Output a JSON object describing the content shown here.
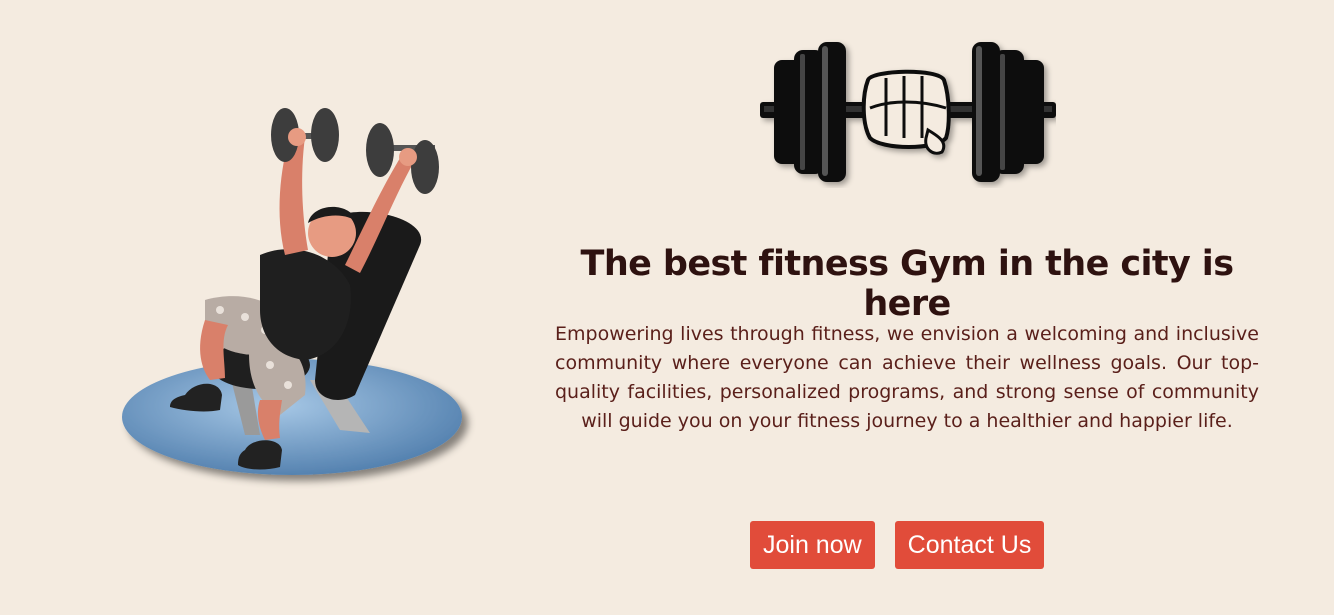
{
  "hero": {
    "headline": "The best fitness Gym in the city is here",
    "description": "Empowering lives through fitness, we envision a welcoming and inclusive community where everyone can achieve their wellness goals. Our top-quality facilities, personalized programs, and strong sense of community will guide you on your fitness journey to a healthier and happier life.",
    "join_label": "Join now",
    "contact_label": "Contact Us"
  },
  "icons": {
    "logo": "dumbbell-fist-icon",
    "illustration": "bench-press-person-icon"
  },
  "colors": {
    "background": "#f4ebe0",
    "headline": "#2e1210",
    "text": "#5a1f1a",
    "button": "#e14c3a",
    "button_text": "#ffffff"
  }
}
